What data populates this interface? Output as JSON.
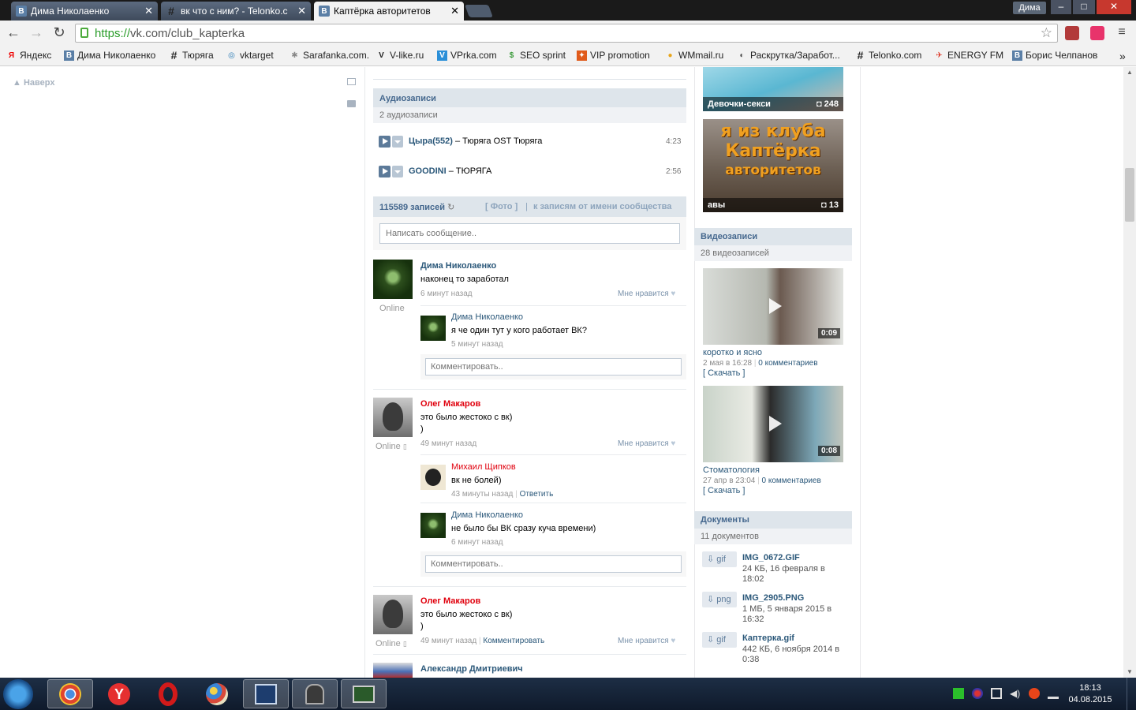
{
  "browser": {
    "tabs": [
      {
        "title": "Дима Николаенко",
        "icon": "vk-icon"
      },
      {
        "title": "вк что с ним? - Telonko.c",
        "icon": "hash-icon"
      },
      {
        "title": "Каптёрка авторитетов",
        "icon": "vk-icon"
      }
    ],
    "user_badge": "Дима",
    "window_controls": {
      "minimize": "–",
      "maximize": "□",
      "close": "✕"
    },
    "url_scheme": "https://",
    "url_rest": "vk.com/club_kapterka",
    "bookmarks": [
      {
        "label": "Яндекс",
        "icon": "yandex-icon"
      },
      {
        "label": "Дима Николаенко",
        "icon": "vk-icon"
      },
      {
        "label": "Тюряга",
        "icon": "hash-icon"
      },
      {
        "label": "vktarget",
        "icon": "vktarget-icon"
      },
      {
        "label": "Sarafanka.com.",
        "icon": "sarafanka-icon"
      },
      {
        "label": "V-like.ru",
        "icon": "vlike-icon"
      },
      {
        "label": "VPrka.com",
        "icon": "vprka-icon"
      },
      {
        "label": "SEO sprint",
        "icon": "seosprint-icon"
      },
      {
        "label": "VIP promotion",
        "icon": "vip-icon"
      },
      {
        "label": "WMmail.ru",
        "icon": "wmmail-icon"
      },
      {
        "label": "Раскрутка/Заработ...",
        "icon": "raskrutka-icon"
      },
      {
        "label": "Telonko.com",
        "icon": "hash-icon"
      },
      {
        "label": "ENERGY FM",
        "icon": "energy-icon"
      },
      {
        "label": "Борис Челпанов",
        "icon": "vk-icon"
      }
    ],
    "bookmarks_more": "»"
  },
  "left": {
    "back_to_top": "Наверх"
  },
  "audio": {
    "header": "Аудиозаписи",
    "count": "2 аудиозаписи",
    "tracks": [
      {
        "artist": "Цыра(552)",
        "title": " – Тюряга OST Тюряга",
        "duration": "4:23"
      },
      {
        "artist": "GOODINI",
        "title": " – ТЮРЯГА",
        "duration": "2:56"
      }
    ]
  },
  "wall": {
    "count": "115589 записей",
    "tab_photo": "[ Фото ]",
    "divider": "|",
    "tab_community": "к записям от имени сообщества",
    "post_placeholder": "Написать сообщение..",
    "comment_placeholder": "Комментировать..",
    "posts": [
      {
        "author": "Дима Николаенко",
        "text": "наконец то заработал",
        "time": "6 минут назад",
        "status": "Online",
        "like": "Мне нравится",
        "replies": [
          {
            "author": "Дима Николаенко",
            "text": "я че один тут у кого работает ВК?",
            "time": "5 минут назад"
          }
        ]
      },
      {
        "author": "Олег Макаров",
        "text1": "это было жестоко с вк)",
        "text2": ")",
        "time": "49 минут назад",
        "status": "Online",
        "like": "Мне нравится",
        "replies": [
          {
            "author": "Михаил Щипков",
            "text": "вк не болей)",
            "time": "43 минуты назад",
            "action": "Ответить"
          },
          {
            "author": "Дима Николаенко",
            "text": "не было бы ВК сразу куча времени)",
            "time": "6 минут назад"
          }
        ]
      },
      {
        "author": "Олег Макаров",
        "text1": "это было жестоко с вк)",
        "text2": ")",
        "time": "49 минут назад",
        "action": "Комментировать",
        "status": "Online",
        "like": "Мне нравится"
      },
      {
        "author": "Александр Дмитриевич"
      }
    ]
  },
  "right": {
    "albums": [
      {
        "title": "Девочки-секси",
        "count": "248"
      },
      {
        "title": "авы",
        "count": "13",
        "art_line1": "я из клуба",
        "art_line2": "Каптёрка",
        "art_line3": "авторитетов"
      }
    ],
    "videos_header": "Видеозаписи",
    "videos_count": "28 видеозаписей",
    "videos": [
      {
        "title": "коротко и ясно",
        "duration": "0:09",
        "date": "2 мая в 16:28",
        "sep": "|",
        "comments": "0 комментариев",
        "download": "[ Скачать ]"
      },
      {
        "title": "Стоматология",
        "duration": "0:08",
        "date": "27 апр в 23:04",
        "sep": "|",
        "comments": "0 комментариев",
        "download": "[ Скачать ]"
      }
    ],
    "docs_header": "Документы",
    "docs_count": "11 документов",
    "docs": [
      {
        "ext": "gif",
        "name": "IMG_0672.GIF",
        "meta": "24 КБ, 16 февраля в 18:02"
      },
      {
        "ext": "png",
        "name": "IMG_2905.PNG",
        "meta": "1 МБ, 5 января 2015 в 16:32"
      },
      {
        "ext": "gif",
        "name": "Каптерка.gif",
        "meta": "442 КБ, 6 ноября 2014 в 0:38"
      }
    ]
  },
  "taskbar": {
    "time": "18:13",
    "date": "04.08.2015"
  }
}
